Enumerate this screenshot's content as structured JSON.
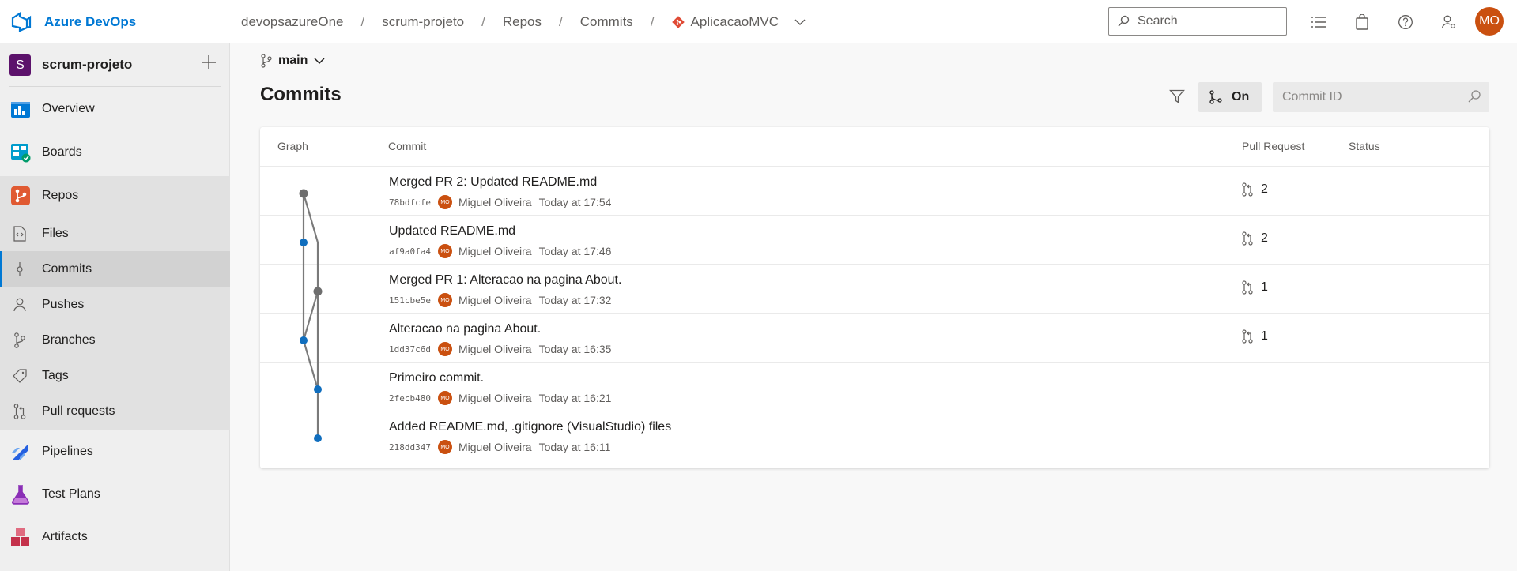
{
  "header": {
    "brand": "Azure DevOps",
    "breadcrumb": [
      "devopsazureOne",
      "scrum-projeto",
      "Repos",
      "Commits"
    ],
    "repo": "AplicacaoMVC",
    "search_placeholder": "Search",
    "user_initials": "MO",
    "icons": [
      "list-icon",
      "shopping-bag-icon",
      "help-icon",
      "user-settings-icon"
    ]
  },
  "sidebar": {
    "project_initial": "S",
    "project_name": "scrum-projeto",
    "items": [
      {
        "label": "Overview",
        "icon": "overview-icon"
      },
      {
        "label": "Boards",
        "icon": "boards-icon"
      },
      {
        "label": "Repos",
        "icon": "repos-icon"
      },
      {
        "label": "Files",
        "icon": "files-icon"
      },
      {
        "label": "Commits",
        "icon": "commit-icon",
        "selected": true
      },
      {
        "label": "Pushes",
        "icon": "pushes-icon"
      },
      {
        "label": "Branches",
        "icon": "branch-icon"
      },
      {
        "label": "Tags",
        "icon": "tag-icon"
      },
      {
        "label": "Pull requests",
        "icon": "pull-request-icon"
      },
      {
        "label": "Pipelines",
        "icon": "pipelines-icon"
      },
      {
        "label": "Test Plans",
        "icon": "test-plans-icon"
      },
      {
        "label": "Artifacts",
        "icon": "artifacts-icon"
      }
    ]
  },
  "main": {
    "branch": "main",
    "title": "Commits",
    "graph_toggle_label": "On",
    "commit_id_placeholder": "Commit ID",
    "columns": [
      "Graph",
      "Commit",
      "Pull Request",
      "Status"
    ],
    "commits": [
      {
        "message": "Merged PR 2: Updated README.md",
        "sha": "78bdfcfe",
        "author": "Miguel Oliveira",
        "author_initials": "MO",
        "time": "Today at 17:54",
        "pr": "2"
      },
      {
        "message": "Updated README.md",
        "sha": "af9a0fa4",
        "author": "Miguel Oliveira",
        "author_initials": "MO",
        "time": "Today at 17:46",
        "pr": "2"
      },
      {
        "message": "Merged PR 1: Alteracao na pagina About.",
        "sha": "151cbe5e",
        "author": "Miguel Oliveira",
        "author_initials": "MO",
        "time": "Today at 17:32",
        "pr": "1"
      },
      {
        "message": "Alteracao na pagina About.",
        "sha": "1dd37c6d",
        "author": "Miguel Oliveira",
        "author_initials": "MO",
        "time": "Today at 16:35",
        "pr": "1"
      },
      {
        "message": "Primeiro commit.",
        "sha": "2fecb480",
        "author": "Miguel Oliveira",
        "author_initials": "MO",
        "time": "Today at 16:21",
        "pr": ""
      },
      {
        "message": "Added README.md, .gitignore (VisualStudio) files",
        "sha": "218dd347",
        "author": "Miguel Oliveira",
        "author_initials": "MO",
        "time": "Today at 16:11",
        "pr": ""
      }
    ]
  },
  "colors": {
    "accent": "#0078d4",
    "avatar": "#ca5010",
    "graph_merge_node": "#6e6e6e",
    "graph_commit_node": "#106ebe"
  }
}
